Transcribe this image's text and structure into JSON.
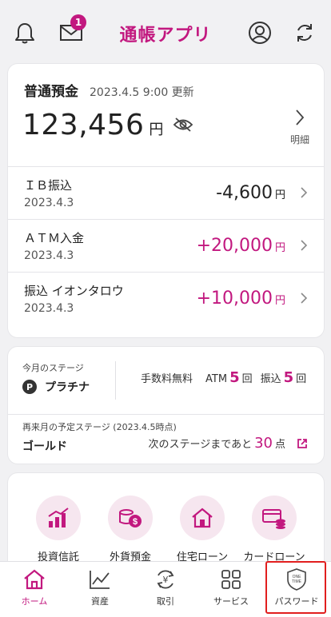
{
  "header": {
    "title": "通帳アプリ",
    "mail_badge": "1",
    "icons": [
      "bell-icon",
      "mail-icon",
      "profile-icon",
      "refresh-icon"
    ]
  },
  "account": {
    "name": "普通預金",
    "updated": "2023.4.5 9:00 更新",
    "balance": "123,456",
    "currency": "円",
    "detail_label": "明細"
  },
  "transactions": [
    {
      "name": "ＩＢ振込",
      "date": "2023.4.3",
      "amount": "-4,600",
      "currency": "円",
      "color": "#222222"
    },
    {
      "name": "ＡＴＭ入金",
      "date": "2023.4.3",
      "amount": "+20,000",
      "currency": "円",
      "color": "#c2187f"
    },
    {
      "name": "振込 イオンタロウ",
      "date": "2023.4.3",
      "amount": "+10,000",
      "currency": "円",
      "color": "#c2187f"
    }
  ],
  "stage": {
    "label": "今月のステージ",
    "badge": "P",
    "name": "プラチナ",
    "fee_label": "手数料無料",
    "atm_label": "ATM",
    "atm_count": "5",
    "transfer_label": "振込",
    "transfer_count": "5",
    "unit": "回",
    "next_label": "再来月の予定ステージ (2023.4.5時点)",
    "next_name": "ゴールド",
    "next_info_prefix": "次のステージまであと",
    "next_points": "30",
    "next_points_unit": "点"
  },
  "services": [
    {
      "label": "投資信託",
      "icon": "investment-chart-icon"
    },
    {
      "label": "外貨預金",
      "icon": "foreign-currency-icon"
    },
    {
      "label": "住宅ローン",
      "icon": "house-icon"
    },
    {
      "label": "カードローン",
      "icon": "card-loan-icon"
    }
  ],
  "nav": [
    {
      "label": "ホーム",
      "icon": "home-icon",
      "active": true
    },
    {
      "label": "資産",
      "icon": "assets-chart-icon",
      "active": false
    },
    {
      "label": "取引",
      "icon": "yen-transfer-icon",
      "active": false
    },
    {
      "label": "サービス",
      "icon": "grid-icon",
      "active": false
    },
    {
      "label": "パスワード",
      "icon": "one-time-password-icon",
      "active": false,
      "icon_text": "ONE TIME"
    }
  ],
  "colors": {
    "accent": "#c2187f",
    "highlight": "#e11e1e"
  }
}
